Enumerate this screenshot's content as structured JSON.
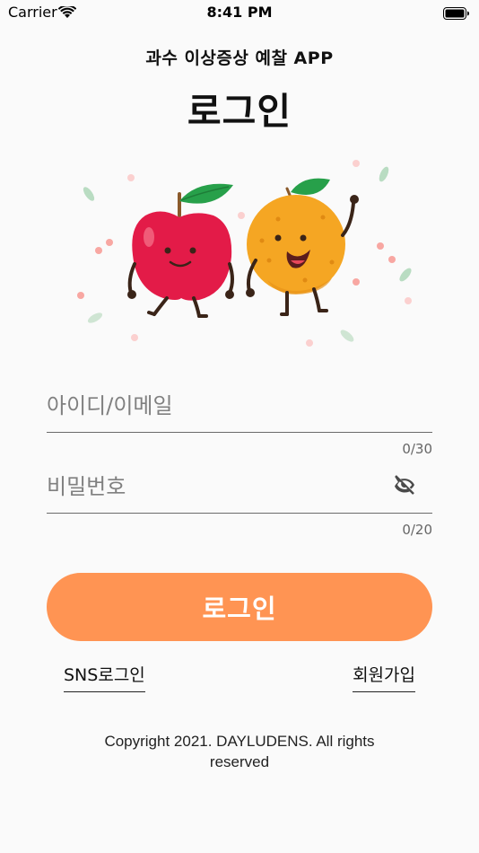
{
  "status_bar": {
    "carrier": "Carrier",
    "time": "8:41 PM"
  },
  "header": {
    "subtitle": "과수 이상증상 예찰 APP",
    "title": "로그인"
  },
  "form": {
    "id_placeholder": "아이디/이메일",
    "id_value": "",
    "id_counter": "0/30",
    "password_placeholder": "비밀번호",
    "password_value": "",
    "password_counter": "0/20",
    "login_label": "로그인"
  },
  "links": {
    "sns_login": "SNS로그인",
    "signup": "회원가입"
  },
  "footer": {
    "copyright": "Copyright 2021. DAYLUDENS. All rights reserved"
  },
  "colors": {
    "accent": "#ff9453",
    "background": "#fafafa",
    "apple": "#e31b48",
    "orange": "#f5a623"
  },
  "icons": [
    "wifi-icon",
    "battery-icon",
    "eye-off-icon",
    "apple-character",
    "orange-character"
  ]
}
